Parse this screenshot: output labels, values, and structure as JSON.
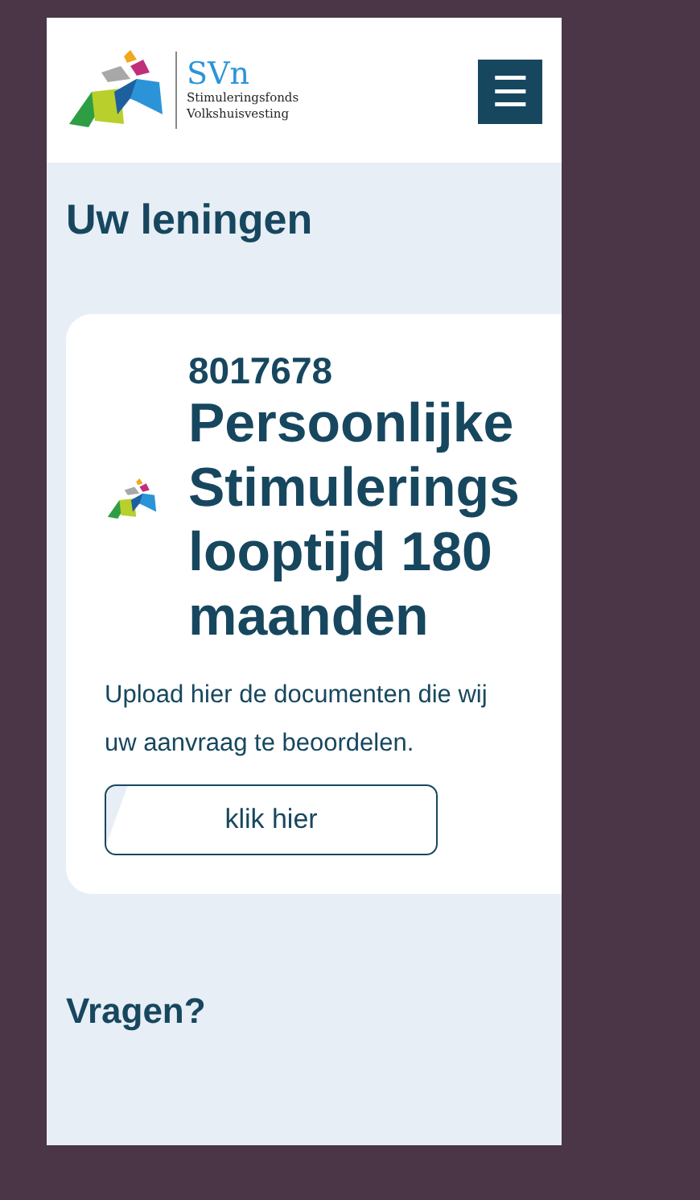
{
  "header": {
    "logo_title": "SVn",
    "logo_subtitle_lines": [
      "Stimuleringsfonds",
      "Volkshuisvesting"
    ],
    "menu_button": "☰"
  },
  "page_title": "Uw leningen",
  "loans": [
    {
      "number": "8017678",
      "title": "Persoonlijke\nStimulerings\nlooptijd 180\nmaanden",
      "description": "Upload hier de documenten die wij\nuw aanvraag te beoordelen.",
      "button": "klik hier"
    }
  ],
  "questions_heading": "Vragen?"
}
